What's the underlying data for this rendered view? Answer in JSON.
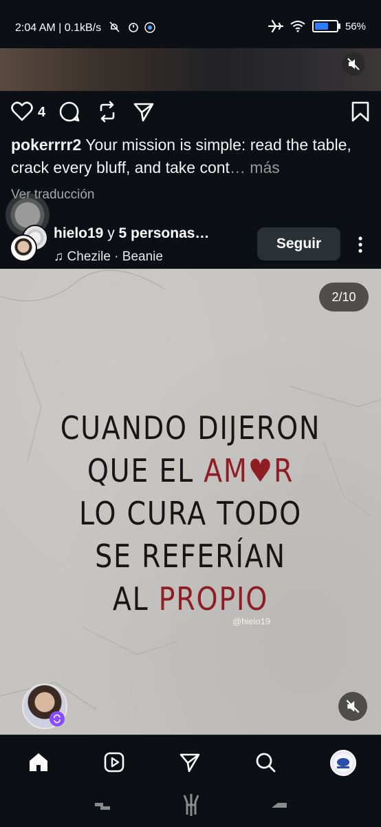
{
  "status_bar": {
    "time": "2:04 AM | 0.1kB/s",
    "battery_text": "56%",
    "battery_level_percent": 56
  },
  "post": {
    "like_count": "4",
    "caption_user": "pokerrrr2",
    "caption_text": " Your mission is simple: read the table, crack every bluff, and take cont",
    "caption_more": "… más",
    "translate_label": "Ver traducción"
  },
  "next_post": {
    "author": "hielo19",
    "author_suffix": " y ",
    "others": "5 personas…",
    "music": "Chezile · Beanie",
    "follow_label": "Seguir",
    "counter": "2/10",
    "image_text": {
      "line1": "CUANDO DIJERON",
      "line2_a": "QUE EL ",
      "line2_b": "AM♥R",
      "line3": "LO CURA TODO",
      "line4": "SE REFERÍAN",
      "line5_a": "AL ",
      "line5_b": "PROPIO",
      "watermark": "@hielo19"
    }
  },
  "bottom_nav": {
    "items": [
      "home-icon",
      "reels-icon",
      "send-icon",
      "search-icon",
      "profile-avatar"
    ]
  },
  "colors": {
    "background": "#0c0f14",
    "button_bg": "#2b2f36",
    "accent_red": "#8e1d24",
    "battery_blue": "#2b7cff"
  }
}
